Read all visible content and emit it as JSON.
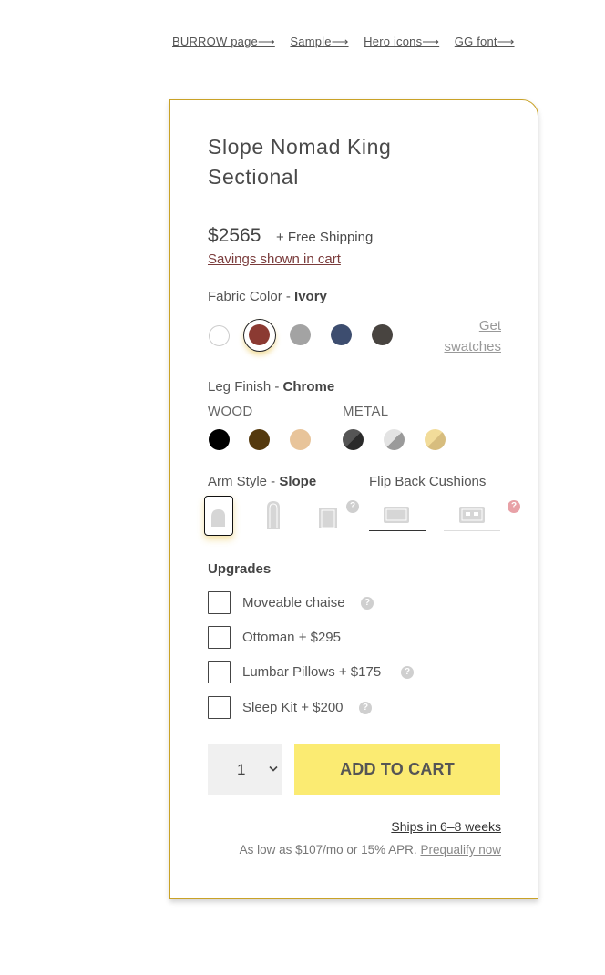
{
  "top_links": [
    "BURROW page⟶",
    "Sample⟶",
    "Hero icons⟶",
    "GG font⟶"
  ],
  "product": {
    "title": "Slope Nomad King Sectional",
    "price": "$2565",
    "shipping": "+ Free Shipping",
    "savings": "Savings shown in cart"
  },
  "fabric": {
    "label": "Fabric Color - ",
    "value": "Ivory",
    "get_swatches": "Get swatches",
    "colors": [
      "#ffffff",
      "#8b3a32",
      "#a3a3a3",
      "#3d4d6f",
      "#484440"
    ]
  },
  "leg": {
    "label": "Leg Finish - ",
    "value": "Chrome",
    "wood_label": "WOOD",
    "metal_label": "METAL"
  },
  "arm": {
    "label": "Arm Style - ",
    "value": "Slope",
    "cushions_label": "Flip Back Cushions"
  },
  "upgrades": {
    "title": "Upgrades",
    "items": [
      "Moveable chaise",
      "Ottoman + $295",
      "Lumbar Pillows + $175",
      "Sleep Kit + $200"
    ]
  },
  "purchase": {
    "quantity": "1",
    "add_to_cart": "ADD TO CART",
    "ships": "Ships in 6–8 weeks",
    "financing": "As low as $107/mo or 15% APR.",
    "prequalify": "Prequalify now"
  }
}
